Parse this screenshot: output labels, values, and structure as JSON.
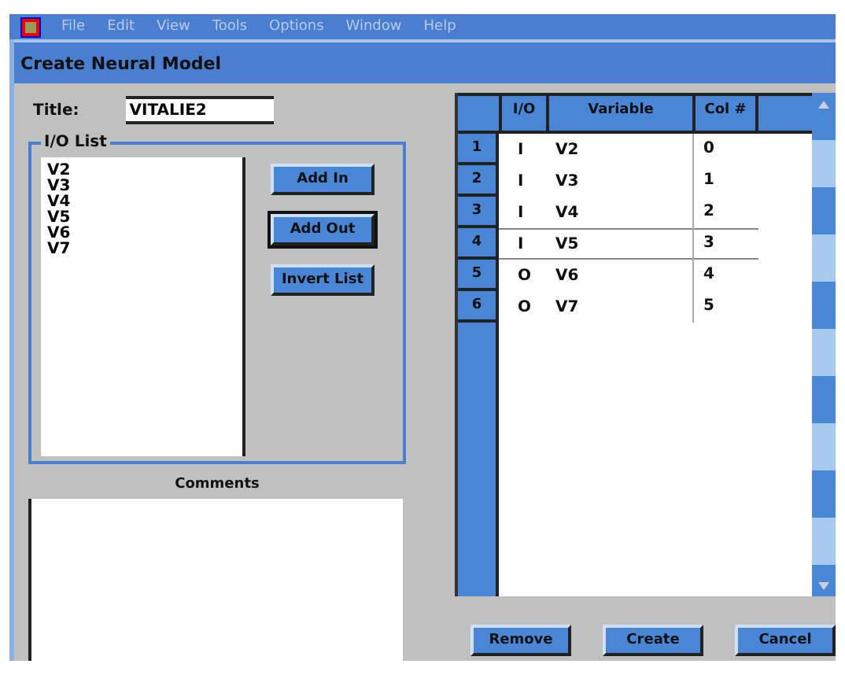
{
  "menu": [
    "File",
    "Edit",
    "View",
    "Tools",
    "Options",
    "Window",
    "Help"
  ],
  "window": {
    "title": "Create Neural Model"
  },
  "title_field": {
    "label": "Title:",
    "value": "VITALIE2"
  },
  "io_list": {
    "label": "I/O List",
    "items": [
      "V2",
      "V3",
      "V4",
      "V5",
      "V6",
      "V7"
    ]
  },
  "side_buttons": [
    {
      "label": "Add In",
      "default": false
    },
    {
      "label": "Add Out",
      "default": true
    },
    {
      "label": "Invert List",
      "default": false
    }
  ],
  "comments": {
    "label": "Comments"
  },
  "table": {
    "columns": [
      "I/O",
      "Variable",
      "Col #"
    ],
    "rows": [
      {
        "num": "1",
        "io": "I",
        "variable": "V2",
        "col": "0",
        "selected": false
      },
      {
        "num": "2",
        "io": "I",
        "variable": "V3",
        "col": "1",
        "selected": false
      },
      {
        "num": "3",
        "io": "I",
        "variable": "V4",
        "col": "2",
        "selected": false
      },
      {
        "num": "4",
        "io": "I",
        "variable": "V5",
        "col": "3",
        "selected": true
      },
      {
        "num": "5",
        "io": "O",
        "variable": "V6",
        "col": "4",
        "selected": false
      },
      {
        "num": "6",
        "io": "O",
        "variable": "V7",
        "col": "5",
        "selected": false
      }
    ]
  },
  "buttons": [
    "Remove",
    "Create",
    "Cancel"
  ]
}
